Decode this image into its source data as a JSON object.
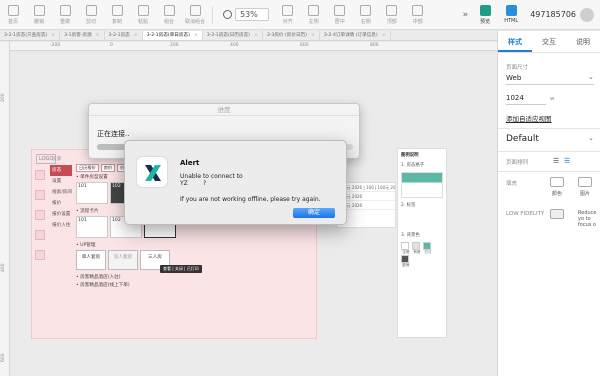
{
  "toolbar": {
    "left_buttons": [
      {
        "label": "首页",
        "icon": "home-icon"
      },
      {
        "label": "撤销",
        "icon": "undo-icon"
      },
      {
        "label": "重做",
        "icon": "redo-icon"
      },
      {
        "label": "剪切",
        "icon": "cut-icon"
      },
      {
        "label": "复制",
        "icon": "copy-icon"
      },
      {
        "label": "粘贴",
        "icon": "paste-icon"
      },
      {
        "label": "组合",
        "icon": "group-icon"
      },
      {
        "label": "取消组合",
        "icon": "ungroup-icon"
      }
    ],
    "zoom": "53%",
    "align_label": "对齐",
    "mid_buttons": [
      {
        "label": "左侧",
        "icon": "align-left-icon"
      },
      {
        "label": "居中",
        "icon": "align-center-icon"
      },
      {
        "label": "右侧",
        "icon": "align-right-icon"
      },
      {
        "label": "顶部",
        "icon": "align-top-icon"
      },
      {
        "label": "中部",
        "icon": "align-middle-icon"
      }
    ],
    "more": "»",
    "preview_label": "预览",
    "html_label": "HTML",
    "user_id": "497185706"
  },
  "tabs": [
    {
      "label": "3-2-1房态(只查房态)",
      "active": false
    },
    {
      "label": "3-1房客-房源",
      "active": false
    },
    {
      "label": "3-2-1房态",
      "active": false
    },
    {
      "label": "3-2-1房态(单日房态)",
      "active": true
    },
    {
      "label": "3-2-1房态(日历房态)",
      "active": false
    },
    {
      "label": "3-3房价 (房价日历)",
      "active": false
    },
    {
      "label": "3-2-4订单详情 (订单信息)",
      "active": false
    }
  ],
  "ruler": {
    "top": [
      "-200",
      "0",
      "200",
      "400",
      "600",
      "800"
    ],
    "left": [
      "200",
      "400",
      "600"
    ]
  },
  "artboard": {
    "logo": "LOGO",
    "nav": [
      "房源",
      "房态",
      "设置",
      "线索/房间",
      "报价",
      "报价设置",
      "报价入住"
    ],
    "headings": [
      "• 单件房型设置",
      "• 流程卡片",
      "• UP管理",
      "• 房客精品酒店(入驻)",
      "• 房客精品酒店(线上下单)"
    ],
    "chips": [
      "日历报价",
      "房价",
      "价格"
    ],
    "tiles_row1": [
      "101",
      "102"
    ],
    "tiles_row2": [
      "101",
      "102",
      "103"
    ],
    "cards": [
      "单人套房",
      "双人套房",
      "三人房"
    ],
    "tooltip": "查看 | 关闭 | 已打印",
    "table_rows": [
      "100元 2026 | 100 | 100元 2026",
      "100元 2026",
      "100元 2026"
    ],
    "aside": {
      "title": "图例说明",
      "items": [
        "1. 房态格子",
        "2. 标签",
        "3. 背景色"
      ],
      "swatch_labels": [
        "空房",
        "有房",
        "已订",
        "脏房"
      ]
    }
  },
  "progress_dialog": {
    "title": "进度",
    "message": "正在连接..",
    "progress": 0.2
  },
  "alert": {
    "title": "Alert",
    "line1": "Unable to connect to",
    "line2": "YZ        ?",
    "line3": "If you are not working offline, please try again.",
    "ok_label": "确定"
  },
  "inspector": {
    "tabs": [
      "样式",
      "交互",
      "说明"
    ],
    "page_size_label": "页面尺寸",
    "page_size_value": "Web",
    "width_value": "1024",
    "width_unit": "w",
    "adaptive_link": "添加自适应视图",
    "style_default": "Default",
    "page_align_label": "页面排列",
    "fill_label": "填充",
    "fill_color": "颜色",
    "fill_image": "图片",
    "low_fidelity_label": "LOW FIDELITY",
    "low_fidelity_desc": "Reduce yo to focus o"
  },
  "colors": {
    "accent": "#1e7fd0",
    "artboard_bg": "#fbe4e6",
    "ok_button": "#2c7ee8",
    "nav_active": "#c54b57"
  }
}
